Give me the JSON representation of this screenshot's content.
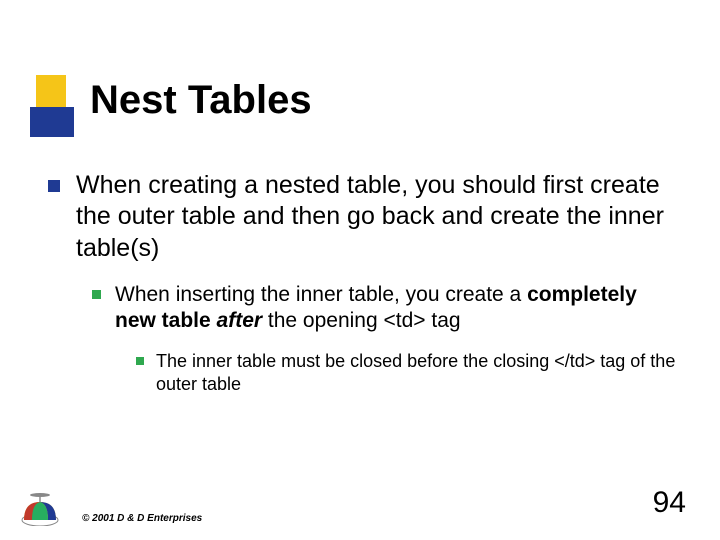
{
  "title": "Nest Tables",
  "bullets": {
    "level1": {
      "text": "When creating a nested table, you should first create the outer table and then go back and create the inner table(s)"
    },
    "level2": {
      "pre": "When inserting the inner table, you create a ",
      "bold": "completely new table ",
      "ital": "after",
      "post1": " the opening <td> tag"
    },
    "level3": {
      "text": "The inner table must be closed before the closing </td> tag of the outer table"
    }
  },
  "footer": {
    "copyright": "© 2001 D & D Enterprises",
    "page": "94"
  }
}
